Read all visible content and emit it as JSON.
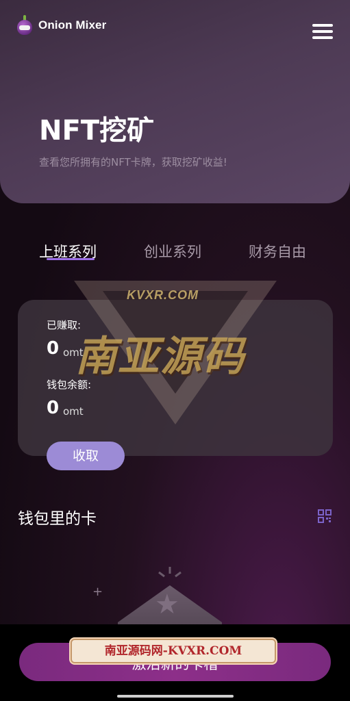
{
  "header": {
    "brand": "Onion Mixer",
    "menu_icon": "hamburger-menu-icon"
  },
  "hero": {
    "title": "NFT挖矿",
    "subtitle": "查看您所拥有的NFT卡牌，获取挖矿收益!"
  },
  "tabs": [
    {
      "label": "上班系列",
      "active": true
    },
    {
      "label": "创业系列",
      "active": false
    },
    {
      "label": "财务自由",
      "active": false
    }
  ],
  "earnings": {
    "earned_label": "已赚取:",
    "earned_value": "0",
    "earned_unit": "omt",
    "balance_label": "钱包余额:",
    "balance_value": "0",
    "balance_unit": "omt",
    "collect_label": "收取"
  },
  "cards_section": {
    "title": "钱包里的卡",
    "qr_icon": "qr-code-icon"
  },
  "footer": {
    "activate_label": "激活新的卡槽"
  },
  "watermark": {
    "domain": "KVXR.COM",
    "big_text": "南亚源码",
    "banner": "南亚源码网-KVXR.COM"
  },
  "colors": {
    "accent": "#9c6fe8",
    "button_purple": "#9c8bd6",
    "activate_magenta": "#8d2f89"
  }
}
